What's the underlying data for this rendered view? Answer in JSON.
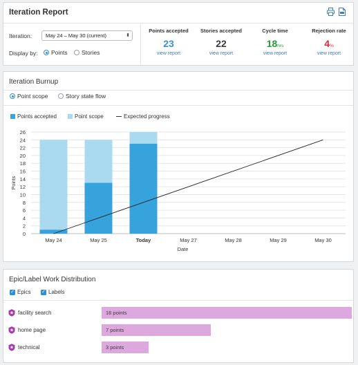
{
  "report": {
    "title": "Iteration Report",
    "icons": [
      "print-icon",
      "csv-export-icon"
    ],
    "iteration_label": "Iteration:",
    "iteration_value": "May 24 – May 30 (current)",
    "display_label": "Display by:",
    "display_options": [
      "Points",
      "Stories"
    ],
    "display_selected": "Points"
  },
  "metrics": [
    {
      "label": "Points accepted",
      "value": "23",
      "unit": "",
      "color": "#3b8fd1",
      "link": "view report"
    },
    {
      "label": "Stories accepted",
      "value": "22",
      "unit": "",
      "color": "#3a3a3a",
      "link": "view report"
    },
    {
      "label": "Cycle time",
      "value": "18",
      "unit": "hrs",
      "color": "#2a9a3a",
      "link": "view report"
    },
    {
      "label": "Rejection rate",
      "value": "4",
      "unit": "%",
      "color": "#e0283c",
      "link": "view report"
    }
  ],
  "burnup": {
    "title": "Iteration Burnup",
    "scope_options": [
      "Point scope",
      "Story state flow"
    ],
    "scope_selected": "Point scope",
    "legend": [
      {
        "label": "Points accepted",
        "color": "#37a3dd"
      },
      {
        "label": "Point scope",
        "color": "#a9daf0"
      },
      {
        "label": "Expected progress",
        "color": "#333333"
      }
    ]
  },
  "chart_data": {
    "type": "bar",
    "categories": [
      "May 24",
      "May 25",
      "Today",
      "May 27",
      "May 28",
      "May 29",
      "May 30"
    ],
    "bold_category": "Today",
    "series": [
      {
        "name": "Points accepted",
        "values": [
          1,
          13,
          23,
          null,
          null,
          null,
          null
        ]
      },
      {
        "name": "Point scope",
        "values": [
          24,
          24,
          26,
          null,
          null,
          null,
          null
        ]
      }
    ],
    "expected_progress": {
      "name": "Expected progress",
      "x": [
        "May 24",
        "May 30"
      ],
      "y": [
        0,
        24
      ]
    },
    "xlabel": "Date",
    "ylabel": "Points",
    "ylim": [
      0,
      26
    ],
    "yticks": [
      0,
      2,
      4,
      6,
      8,
      10,
      12,
      14,
      16,
      18,
      20,
      22,
      24,
      26
    ],
    "grid": true
  },
  "distribution": {
    "title": "Epic/Label Work Distribution",
    "filters": [
      "Epics",
      "Labels"
    ],
    "max_points": 16,
    "rows": [
      {
        "name": "facility search",
        "points": 16,
        "label": "16 points"
      },
      {
        "name": "home page",
        "points": 7,
        "label": "7 points"
      },
      {
        "name": "technical",
        "points": 3,
        "label": "3 points"
      }
    ]
  }
}
